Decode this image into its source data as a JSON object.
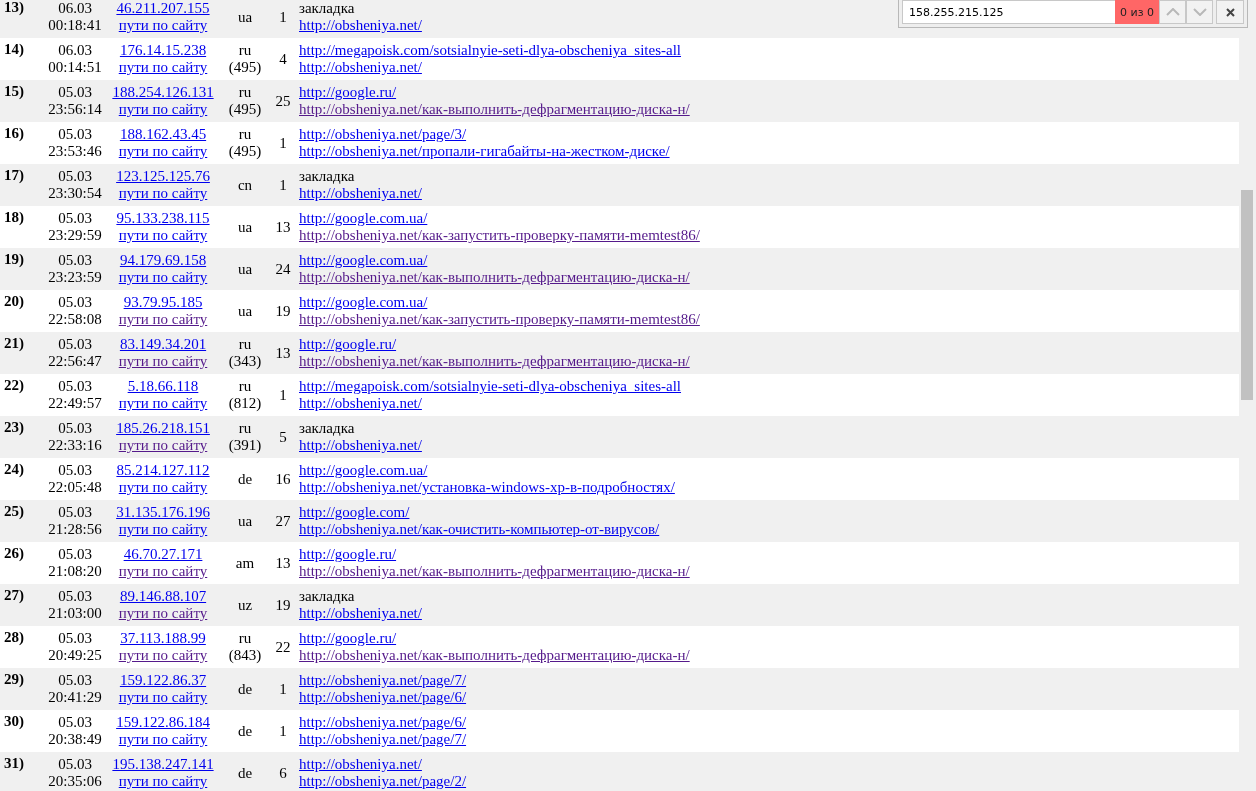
{
  "find_bar": {
    "query": "158.255.215.125",
    "result": "0 из 0"
  },
  "rows": [
    {
      "num": "13)",
      "date": "06.03",
      "time": "00:18:41",
      "ip": {
        "text": "46.211.207.155",
        "visited": false
      },
      "paths": {
        "text": "пути по сайту",
        "visited": false
      },
      "country": "ua",
      "hits": "1",
      "source": {
        "kind": "text",
        "text": "закладка"
      },
      "landing": {
        "text": "http://obsheniya.net/",
        "visited": false
      }
    },
    {
      "num": "14)",
      "date": "06.03",
      "time": "00:14:51",
      "ip": {
        "text": "176.14.15.238",
        "visited": false
      },
      "paths": {
        "text": "пути по сайту",
        "visited": false
      },
      "country": "ru",
      "region": "(495)",
      "hits": "4",
      "source": {
        "kind": "link",
        "text": "http://megapoisk.com/sotsialnyie-seti-dlya-obscheniya_sites-all",
        "visited": false
      },
      "landing": {
        "text": "http://obsheniya.net/",
        "visited": false
      }
    },
    {
      "num": "15)",
      "date": "05.03",
      "time": "23:56:14",
      "ip": {
        "text": "188.254.126.131",
        "visited": false
      },
      "paths": {
        "text": "пути по сайту",
        "visited": false
      },
      "country": "ru",
      "region": "(495)",
      "hits": "25",
      "source": {
        "kind": "link",
        "text": "http://google.ru/",
        "visited": false
      },
      "landing": {
        "text": "http://obsheniya.net/как-выполнить-дефрагментацию-диска-н/",
        "visited": true
      }
    },
    {
      "num": "16)",
      "date": "05.03",
      "time": "23:53:46",
      "ip": {
        "text": "188.162.43.45",
        "visited": false
      },
      "paths": {
        "text": "пути по сайту",
        "visited": false
      },
      "country": "ru",
      "region": "(495)",
      "hits": "1",
      "source": {
        "kind": "link",
        "text": "http://obsheniya.net/page/3/",
        "visited": false
      },
      "landing": {
        "text": "http://obsheniya.net/пропали-гигабайты-на-жестком-диске/",
        "visited": false
      }
    },
    {
      "num": "17)",
      "date": "05.03",
      "time": "23:30:54",
      "ip": {
        "text": "123.125.125.76",
        "visited": false
      },
      "paths": {
        "text": "пути по сайту",
        "visited": false
      },
      "country": "cn",
      "hits": "1",
      "source": {
        "kind": "text",
        "text": "закладка"
      },
      "landing": {
        "text": "http://obsheniya.net/",
        "visited": false
      }
    },
    {
      "num": "18)",
      "date": "05.03",
      "time": "23:29:59",
      "ip": {
        "text": "95.133.238.115",
        "visited": false
      },
      "paths": {
        "text": "пути по сайту",
        "visited": false
      },
      "country": "ua",
      "hits": "13",
      "source": {
        "kind": "link",
        "text": "http://google.com.ua/",
        "visited": false
      },
      "landing": {
        "text": "http://obsheniya.net/как-запустить-проверку-памяти-memtest86/",
        "visited": true
      }
    },
    {
      "num": "19)",
      "date": "05.03",
      "time": "23:23:59",
      "ip": {
        "text": "94.179.69.158",
        "visited": false
      },
      "paths": {
        "text": "пути по сайту",
        "visited": false
      },
      "country": "ua",
      "hits": "24",
      "source": {
        "kind": "link",
        "text": "http://google.com.ua/",
        "visited": false
      },
      "landing": {
        "text": "http://obsheniya.net/как-выполнить-дефрагментацию-диска-н/",
        "visited": true
      }
    },
    {
      "num": "20)",
      "date": "05.03",
      "time": "22:58:08",
      "ip": {
        "text": "93.79.95.185",
        "visited": false
      },
      "paths": {
        "text": "пути по сайту",
        "visited": true
      },
      "country": "ua",
      "hits": "19",
      "source": {
        "kind": "link",
        "text": "http://google.com.ua/",
        "visited": false
      },
      "landing": {
        "text": "http://obsheniya.net/как-запустить-проверку-памяти-memtest86/",
        "visited": true
      }
    },
    {
      "num": "21)",
      "date": "05.03",
      "time": "22:56:47",
      "ip": {
        "text": "83.149.34.201",
        "visited": false
      },
      "paths": {
        "text": "пути по сайту",
        "visited": true
      },
      "country": "ru",
      "region": "(343)",
      "hits": "13",
      "source": {
        "kind": "link",
        "text": "http://google.ru/",
        "visited": false
      },
      "landing": {
        "text": "http://obsheniya.net/как-выполнить-дефрагментацию-диска-н/",
        "visited": true
      }
    },
    {
      "num": "22)",
      "date": "05.03",
      "time": "22:49:57",
      "ip": {
        "text": "5.18.66.118",
        "visited": false
      },
      "paths": {
        "text": "пути по сайту",
        "visited": false
      },
      "country": "ru",
      "region": "(812)",
      "hits": "1",
      "source": {
        "kind": "link",
        "text": "http://megapoisk.com/sotsialnyie-seti-dlya-obscheniya_sites-all",
        "visited": false
      },
      "landing": {
        "text": "http://obsheniya.net/",
        "visited": false
      }
    },
    {
      "num": "23)",
      "date": "05.03",
      "time": "22:33:16",
      "ip": {
        "text": "185.26.218.151",
        "visited": false
      },
      "paths": {
        "text": "пути по сайту",
        "visited": true
      },
      "country": "ru",
      "region": "(391)",
      "hits": "5",
      "source": {
        "kind": "text",
        "text": "закладка"
      },
      "landing": {
        "text": "http://obsheniya.net/",
        "visited": false
      }
    },
    {
      "num": "24)",
      "date": "05.03",
      "time": "22:05:48",
      "ip": {
        "text": "85.214.127.112",
        "visited": false
      },
      "paths": {
        "text": "пути по сайту",
        "visited": false
      },
      "country": "de",
      "hits": "16",
      "source": {
        "kind": "link",
        "text": "http://google.com.ua/",
        "visited": false
      },
      "landing": {
        "text": "http://obsheniya.net/установка-windows-xp-в-подробностях/",
        "visited": false
      }
    },
    {
      "num": "25)",
      "date": "05.03",
      "time": "21:28:56",
      "ip": {
        "text": "31.135.176.196",
        "visited": false
      },
      "paths": {
        "text": "пути по сайту",
        "visited": false
      },
      "country": "ua",
      "hits": "27",
      "source": {
        "kind": "link",
        "text": "http://google.com/",
        "visited": false
      },
      "landing": {
        "text": "http://obsheniya.net/как-очистить-компьютер-от-вирусов/",
        "visited": false
      }
    },
    {
      "num": "26)",
      "date": "05.03",
      "time": "21:08:20",
      "ip": {
        "text": "46.70.27.171",
        "visited": false
      },
      "paths": {
        "text": "пути по сайту",
        "visited": true
      },
      "country": "am",
      "hits": "13",
      "source": {
        "kind": "link",
        "text": "http://google.ru/",
        "visited": false
      },
      "landing": {
        "text": "http://obsheniya.net/как-выполнить-дефрагментацию-диска-н/",
        "visited": true
      }
    },
    {
      "num": "27)",
      "date": "05.03",
      "time": "21:03:00",
      "ip": {
        "text": "89.146.88.107",
        "visited": false
      },
      "paths": {
        "text": "пути по сайту",
        "visited": true
      },
      "country": "uz",
      "hits": "19",
      "source": {
        "kind": "text",
        "text": "закладка"
      },
      "landing": {
        "text": "http://obsheniya.net/",
        "visited": false
      }
    },
    {
      "num": "28)",
      "date": "05.03",
      "time": "20:49:25",
      "ip": {
        "text": "37.113.188.99",
        "visited": false
      },
      "paths": {
        "text": "пути по сайту",
        "visited": true
      },
      "country": "ru",
      "region": "(843)",
      "hits": "22",
      "source": {
        "kind": "link",
        "text": "http://google.ru/",
        "visited": false
      },
      "landing": {
        "text": "http://obsheniya.net/как-выполнить-дефрагментацию-диска-н/",
        "visited": true
      }
    },
    {
      "num": "29)",
      "date": "05.03",
      "time": "20:41:29",
      "ip": {
        "text": "159.122.86.37",
        "visited": false
      },
      "paths": {
        "text": "пути по сайту",
        "visited": false
      },
      "country": "de",
      "hits": "1",
      "source": {
        "kind": "link",
        "text": "http://obsheniya.net/page/7/",
        "visited": false
      },
      "landing": {
        "text": "http://obsheniya.net/page/6/",
        "visited": false
      }
    },
    {
      "num": "30)",
      "date": "05.03",
      "time": "20:38:49",
      "ip": {
        "text": "159.122.86.184",
        "visited": false
      },
      "paths": {
        "text": "пути по сайту",
        "visited": false
      },
      "country": "de",
      "hits": "1",
      "source": {
        "kind": "link",
        "text": "http://obsheniya.net/page/6/",
        "visited": false
      },
      "landing": {
        "text": "http://obsheniya.net/page/7/",
        "visited": false
      }
    },
    {
      "num": "31)",
      "date": "05.03",
      "time": "20:35:06",
      "ip": {
        "text": "195.138.247.141",
        "visited": false
      },
      "paths": {
        "text": "пути по сайту",
        "visited": false
      },
      "country": "de",
      "hits": "6",
      "source": {
        "kind": "link",
        "text": "http://obsheniya.net/",
        "visited": false
      },
      "landing": {
        "text": "http://obsheniya.net/page/2/",
        "visited": false
      }
    }
  ]
}
